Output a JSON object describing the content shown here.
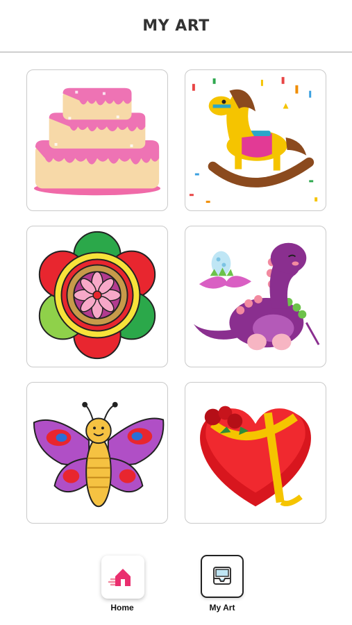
{
  "header": {
    "title": "MY ART"
  },
  "gallery": {
    "items": [
      {
        "subject": "three-tier pink cake"
      },
      {
        "subject": "rocking horse with confetti"
      },
      {
        "subject": "colorful mandala flower"
      },
      {
        "subject": "purple dinosaur with egg"
      },
      {
        "subject": "smiling butterfly"
      },
      {
        "subject": "red heart gift box"
      }
    ]
  },
  "bottom_nav": {
    "home_label": "Home",
    "myart_label": "My Art"
  },
  "colors": {
    "accent_pink": "#ea2e6e",
    "border": "#c9c9c9",
    "divider": "#cfcfcf"
  }
}
